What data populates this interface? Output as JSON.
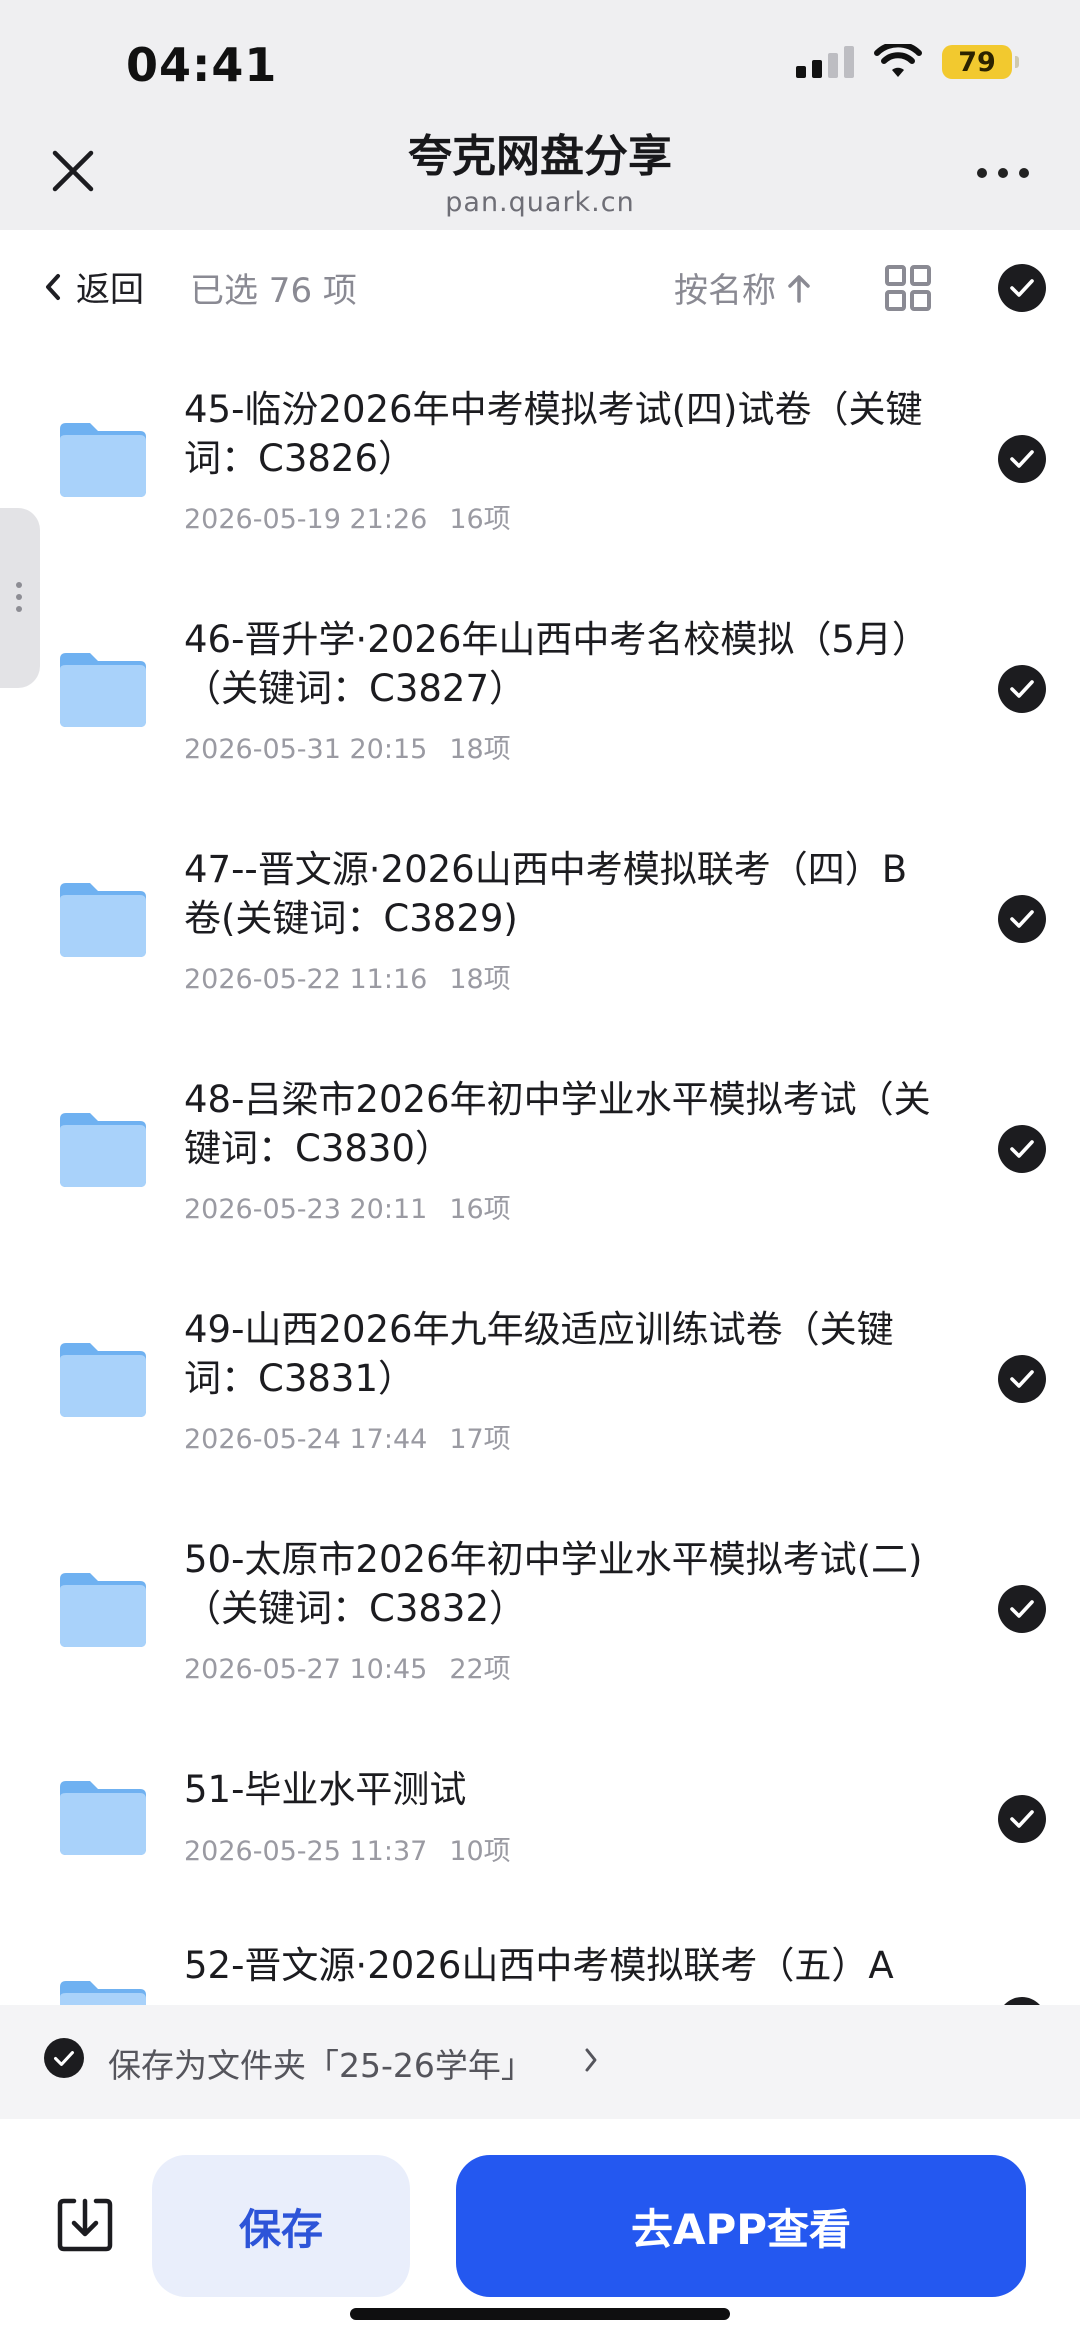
{
  "status_bar": {
    "time": "04:41",
    "battery": "79"
  },
  "header": {
    "title": "夸克网盘分享",
    "url": "pan.quark.cn"
  },
  "toolbar": {
    "back_label": "返回",
    "selected_label": "已选 76 项",
    "sort_label": "按名称"
  },
  "files": [
    {
      "name": "45-临汾2026年中考模拟考试(四)试卷（关键词：C3826）",
      "date": "2026-05-19 21:26",
      "count": "16项"
    },
    {
      "name": "46-晋升学·2026年山西中考名校模拟（5月）（关键词：C3827）",
      "date": "2026-05-31 20:15",
      "count": "18项"
    },
    {
      "name": "47--晋文源·2026山西中考模拟联考（四）B卷(关键词：C3829)",
      "date": "2026-05-22 11:16",
      "count": "18项"
    },
    {
      "name": "48-吕梁市2026年初中学业水平模拟考试（关键词：C3830）",
      "date": "2026-05-23 20:11",
      "count": "16项"
    },
    {
      "name": "49-山西2026年九年级适应训练试卷（关键词：C3831）",
      "date": "2026-05-24 17:44",
      "count": "17项"
    },
    {
      "name": "50-太原市2026年初中学业水平模拟考试(二)（关键词：C3832）",
      "date": "2026-05-27 10:45",
      "count": "22项"
    },
    {
      "name": "51-毕业水平测试",
      "date": "2026-05-25 11:37",
      "count": "10项"
    },
    {
      "name": "52-晋文源·2026山西中考模拟联考（五）A",
      "date": "",
      "count": ""
    }
  ],
  "save_banner": {
    "label": "保存为文件夹「25-26学年」"
  },
  "bottom": {
    "save_label": "保存",
    "open_app_label": "去APP查看"
  },
  "colors": {
    "primary": "#2458f0",
    "save_bg": "#e9eefb",
    "save_text": "#2d54d8",
    "header_bg": "#efeff1",
    "folder": "#8ec2f6",
    "check": "#1c1c1f"
  }
}
